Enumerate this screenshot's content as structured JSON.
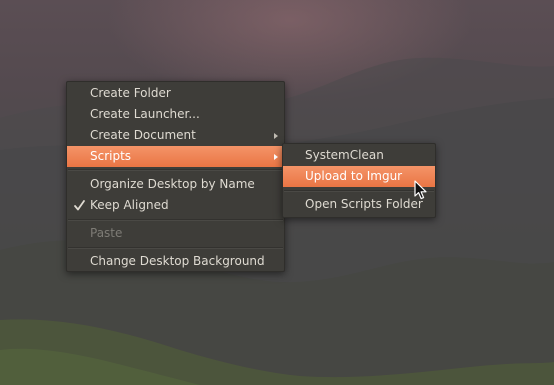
{
  "desktop": {
    "background_colors": [
      "#5b4e54",
      "#4b4a4b",
      "#4a4d3b"
    ]
  },
  "context_menu": {
    "items": [
      {
        "label": "Create Folder"
      },
      {
        "label": "Create Launcher..."
      },
      {
        "label": "Create Document",
        "has_submenu": true
      },
      {
        "label": "Scripts",
        "has_submenu": true,
        "highlighted": true
      },
      {
        "label": "Organize Desktop by Name"
      },
      {
        "label": "Keep Aligned",
        "checked": true
      },
      {
        "label": "Paste",
        "disabled": true
      },
      {
        "label": "Change Desktop Background"
      }
    ]
  },
  "scripts_submenu": {
    "items": [
      {
        "label": "SystemClean"
      },
      {
        "label": "Upload to Imgur",
        "highlighted": true
      },
      {
        "label": "Open Scripts Folder"
      }
    ]
  },
  "colors": {
    "highlight": "#ea7544",
    "menu_background": "#3e3d39",
    "menu_text": "#dfdbd2",
    "disabled_text": "#7e7c76"
  },
  "icons": {
    "submenu_arrow": "chevron-right-icon",
    "check": "checkmark-icon",
    "pointer": "mouse-pointer-icon"
  }
}
